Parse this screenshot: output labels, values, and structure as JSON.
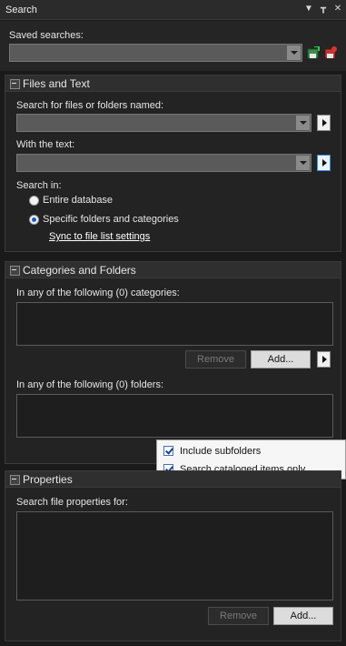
{
  "window": {
    "title": "Search",
    "pin_icon": "pin-icon",
    "close_icon": "close-icon",
    "menu_icon": "dropdown-arrow-icon"
  },
  "saved": {
    "label": "Saved searches:",
    "value": "",
    "save_icon": "save-search-icon",
    "delete_icon": "delete-search-icon"
  },
  "files_text": {
    "header": "Files and Text",
    "name_label": "Search for files or folders named:",
    "name_value": "",
    "text_label": "With the text:",
    "text_value": "",
    "search_in_label": "Search in:",
    "options": [
      "Entire database",
      "Specific folders and categories"
    ],
    "selected_option": "Specific folders and categories",
    "sync_link": "Sync to file list settings"
  },
  "cat_folders": {
    "header": "Categories and Folders",
    "categories_label": "In any of the following (0) categories:",
    "categories": [],
    "remove_label": "Remove",
    "add_label": "Add...",
    "folders_label": "In any of the following (0) folders:",
    "folders": [],
    "popup": {
      "items": [
        {
          "label": "Include subfolders",
          "checked": true
        },
        {
          "label": "Search cataloged items only",
          "checked": true
        }
      ]
    }
  },
  "properties": {
    "header": "Properties",
    "label": "Search file properties for:",
    "items": [],
    "remove_label": "Remove",
    "add_label": "Add..."
  },
  "colors": {
    "accent": "#3a8ee6",
    "background": "#1a1a1a"
  }
}
